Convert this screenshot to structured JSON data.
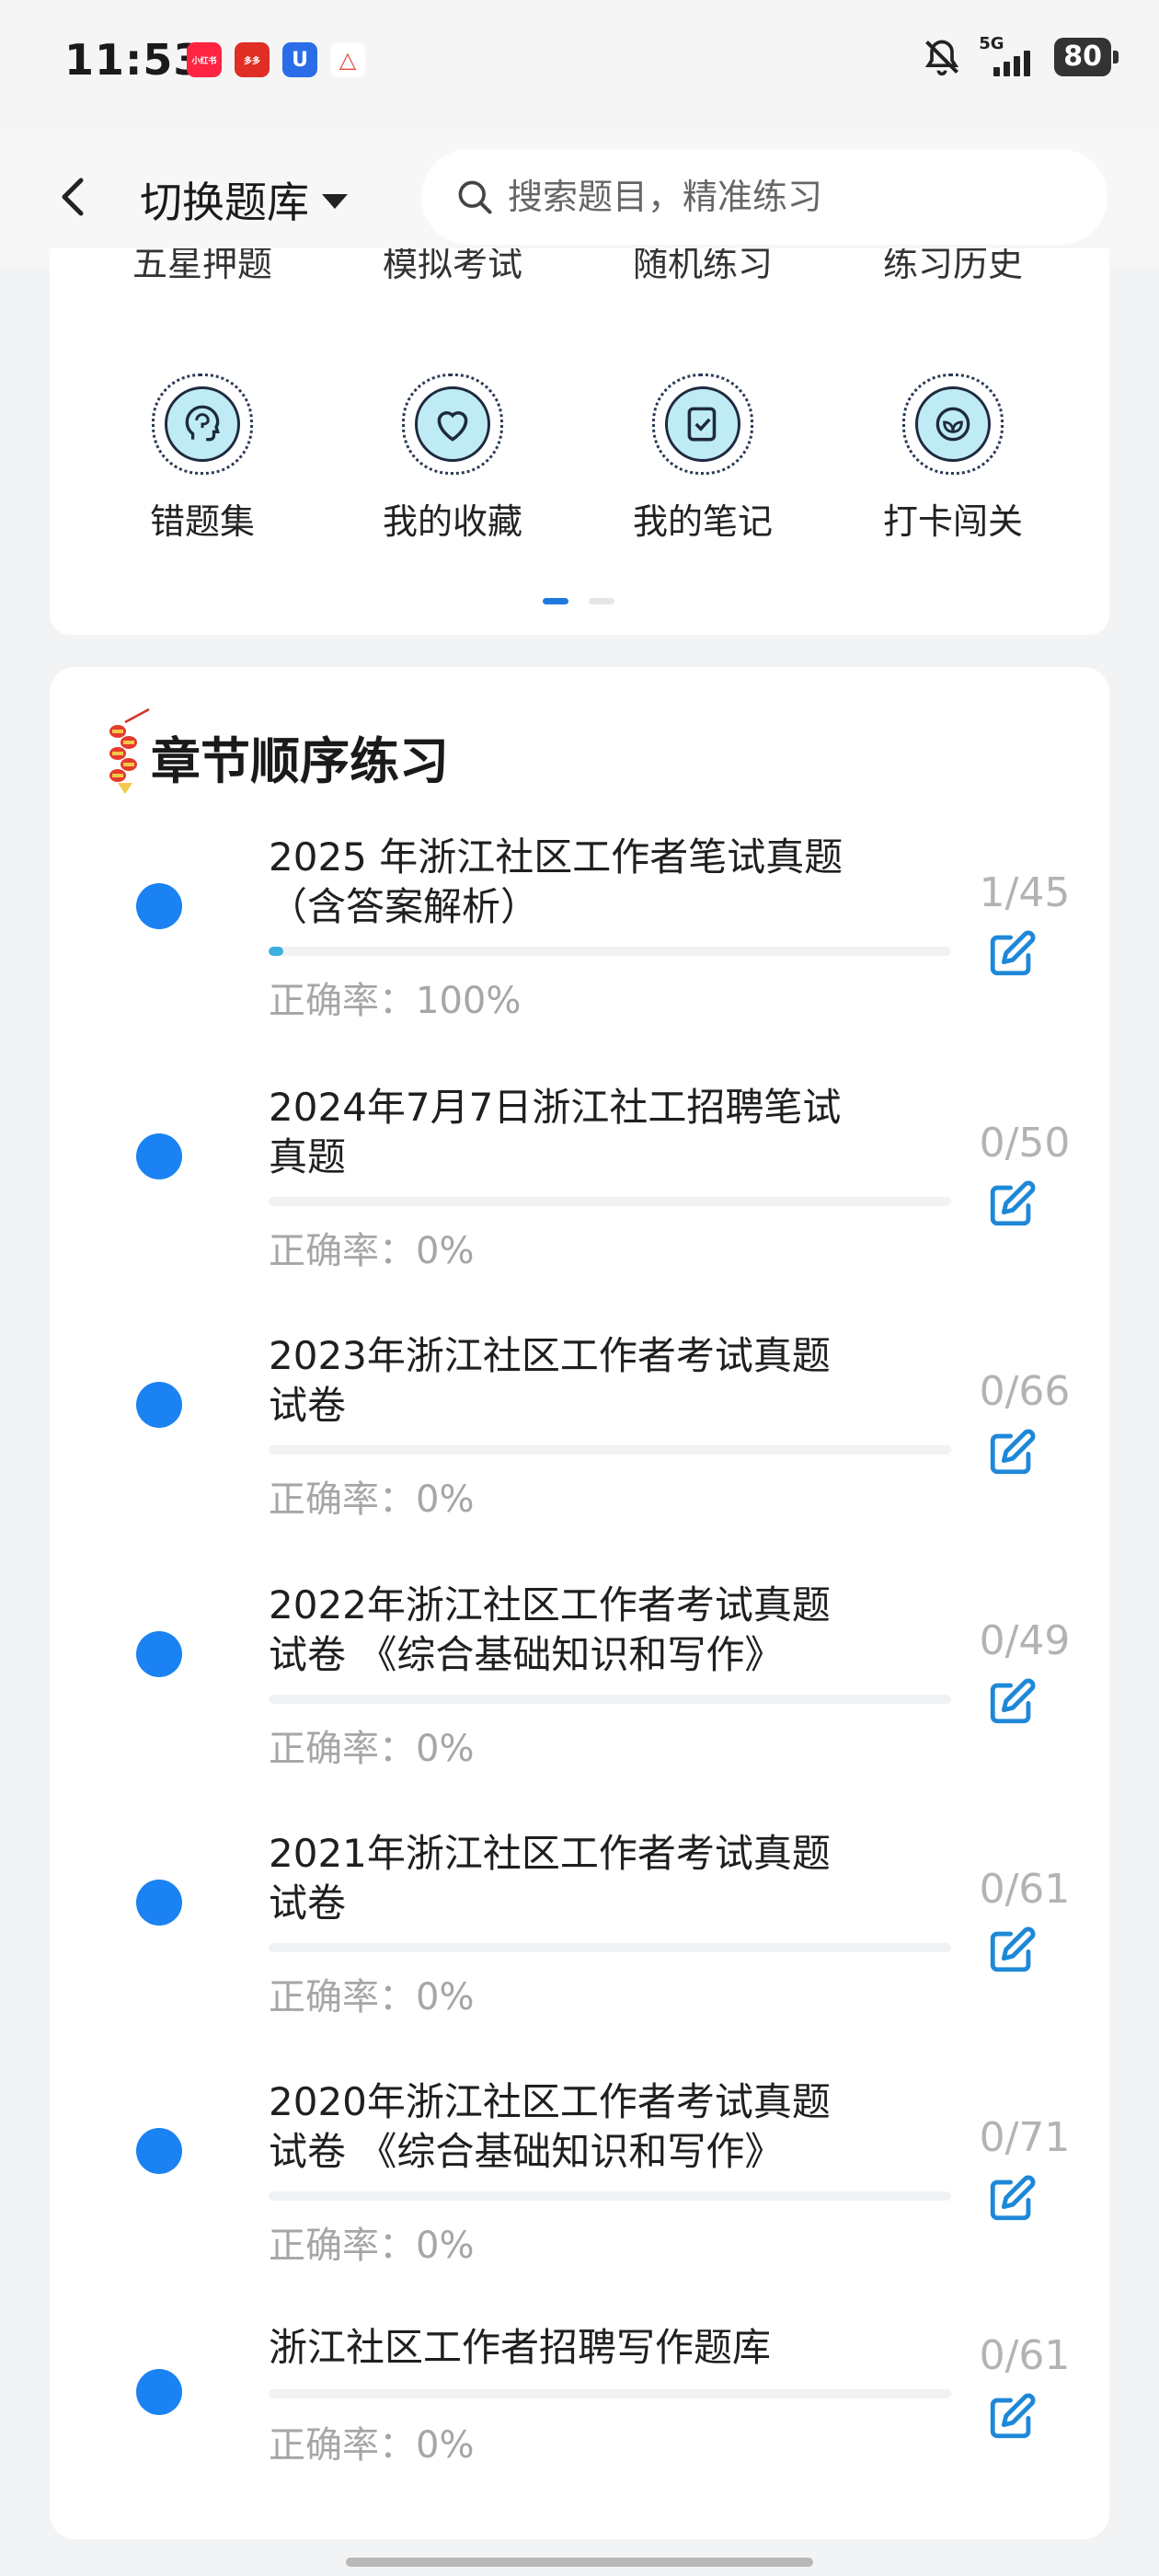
{
  "status_bar": {
    "time": "11:53",
    "notification_apps": [
      {
        "icon": "xiaohongshu-app-icon",
        "label": "小红书",
        "color": "#ff2442"
      },
      {
        "icon": "pinduoduo-app-icon",
        "label": "多多",
        "color": "#e02e24"
      },
      {
        "icon": "shield-app-icon",
        "label": "U",
        "color": "#2b6de8"
      },
      {
        "icon": "sail-app-icon",
        "label": "△",
        "color": "#e8493d"
      }
    ],
    "network": "5G",
    "battery": "80"
  },
  "header": {
    "back_icon": "chevron-left-icon",
    "switch_label": "切换题库",
    "search_placeholder": "搜索题目，精准练习"
  },
  "tools": {
    "cut_off_row": [
      "五星押题",
      "模拟考试",
      "随机练习",
      "练习历史"
    ],
    "items": [
      {
        "label": "错题集",
        "icon": "brain-head-icon"
      },
      {
        "label": "我的收藏",
        "icon": "heart-icon"
      },
      {
        "label": "我的笔记",
        "icon": "note-check-icon"
      },
      {
        "label": "打卡闯关",
        "icon": "leaf-badge-icon"
      }
    ],
    "page_index": 1,
    "page_count": 2
  },
  "chapters": {
    "title": "章节顺序练习",
    "accent": "#1a82f2",
    "items": [
      {
        "title": "2025 年浙江社区工作者笔试真题（含答案解析）",
        "accuracy": "正确率：100%",
        "count": "1/45",
        "progress": 0.0222
      },
      {
        "title": "2024年7月7日浙江社工招聘笔试真题",
        "accuracy": "正确率：0%",
        "count": "0/50",
        "progress": 0
      },
      {
        "title": "2023年浙江社区工作者考试真题试卷",
        "accuracy": "正确率：0%",
        "count": "0/66",
        "progress": 0
      },
      {
        "title": "2022年浙江社区工作者考试真题试卷 《综合基础知识和写作》",
        "accuracy": "正确率：0%",
        "count": "0/49",
        "progress": 0
      },
      {
        "title": "2021年浙江社区工作者考试真题试卷",
        "accuracy": "正确率：0%",
        "count": "0/61",
        "progress": 0
      },
      {
        "title": "2020年浙江社区工作者考试真题试卷 《综合基础知识和写作》",
        "accuracy": "正确率：0%",
        "count": "0/71",
        "progress": 0
      },
      {
        "title": "浙江社区工作者招聘写作题库",
        "accuracy": "正确率：0%",
        "count": "0/61",
        "progress": 0
      }
    ]
  }
}
